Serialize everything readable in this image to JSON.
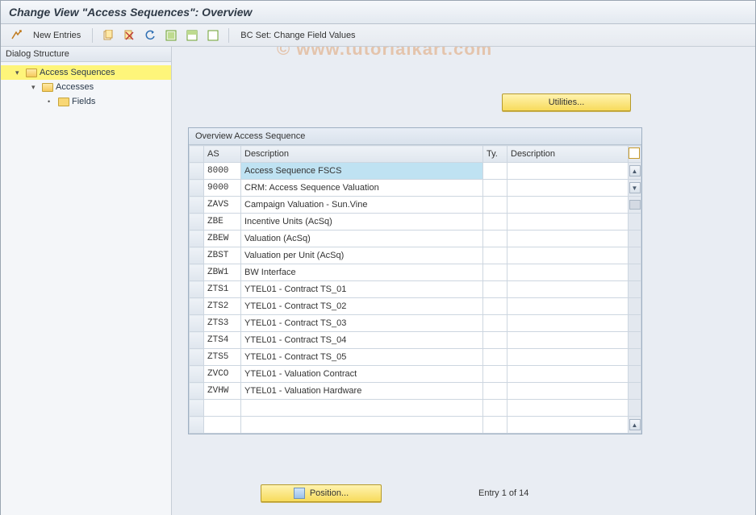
{
  "title": "Change View \"Access Sequences\": Overview",
  "toolbar": {
    "new_entries": "New Entries",
    "bc_set": "BC Set: Change Field Values"
  },
  "watermark": "© www.tutorialkart.com",
  "sidebar": {
    "header": "Dialog Structure",
    "items": [
      {
        "label": "Access Sequences",
        "level": 1,
        "open": true,
        "selected": true
      },
      {
        "label": "Accesses",
        "level": 2,
        "open": true,
        "selected": false
      },
      {
        "label": "Fields",
        "level": 3,
        "open": false,
        "selected": false
      }
    ]
  },
  "utilities_btn": "Utilities...",
  "grid": {
    "title": "Overview Access Sequence",
    "columns": {
      "as": "AS",
      "desc": "Description",
      "ty": "Ty.",
      "desc2": "Description"
    },
    "rows": [
      {
        "as": "8000",
        "desc": "Access Sequence FSCS",
        "selected": true
      },
      {
        "as": "9000",
        "desc": "CRM: Access Sequence Valuation"
      },
      {
        "as": "ZAVS",
        "desc": "Campaign Valuation - Sun.Vine"
      },
      {
        "as": "ZBE",
        "desc": "Incentive Units (AcSq)"
      },
      {
        "as": "ZBEW",
        "desc": "Valuation (AcSq)"
      },
      {
        "as": "ZBST",
        "desc": "Valuation per Unit (AcSq)"
      },
      {
        "as": "ZBW1",
        "desc": "BW Interface"
      },
      {
        "as": "ZTS1",
        "desc": "YTEL01 - Contract TS_01"
      },
      {
        "as": "ZTS2",
        "desc": "YTEL01 - Contract TS_02"
      },
      {
        "as": "ZTS3",
        "desc": "YTEL01 - Contract TS_03"
      },
      {
        "as": "ZTS4",
        "desc": "YTEL01 - Contract TS_04"
      },
      {
        "as": "ZTS5",
        "desc": "YTEL01 - Contract TS_05"
      },
      {
        "as": "ZVCO",
        "desc": "YTEL01 - Valuation Contract"
      },
      {
        "as": "ZVHW",
        "desc": "YTEL01 - Valuation Hardware"
      }
    ]
  },
  "position_btn": "Position...",
  "entry_status": "Entry 1 of 14"
}
